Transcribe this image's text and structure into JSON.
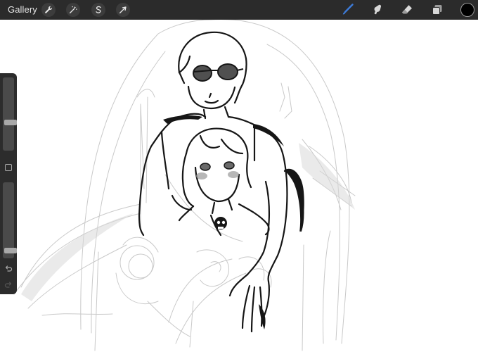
{
  "app": {
    "gallery_label": "Gallery"
  },
  "toolbar": {
    "left_tools": [
      {
        "name": "actions",
        "icon": "wrench-icon"
      },
      {
        "name": "adjustments",
        "icon": "magic-wand-icon"
      },
      {
        "name": "selection",
        "icon": "selection-s-icon"
      },
      {
        "name": "transform",
        "icon": "arrow-cursor-icon"
      }
    ],
    "right_tools": [
      {
        "name": "brush",
        "icon": "brush-icon",
        "active": true
      },
      {
        "name": "smudge",
        "icon": "smudge-icon",
        "active": false
      },
      {
        "name": "eraser",
        "icon": "eraser-icon",
        "active": false
      },
      {
        "name": "layers",
        "icon": "layers-icon",
        "active": false
      }
    ],
    "current_color": "#000000"
  },
  "sidebar": {
    "brush_size_level": 0.37,
    "opacity_level": 0.07
  },
  "colors": {
    "toolbar_bg": "#2b2b2b",
    "accent_active": "#3d7bd9",
    "icon_inactive": "#d8d8d8"
  }
}
